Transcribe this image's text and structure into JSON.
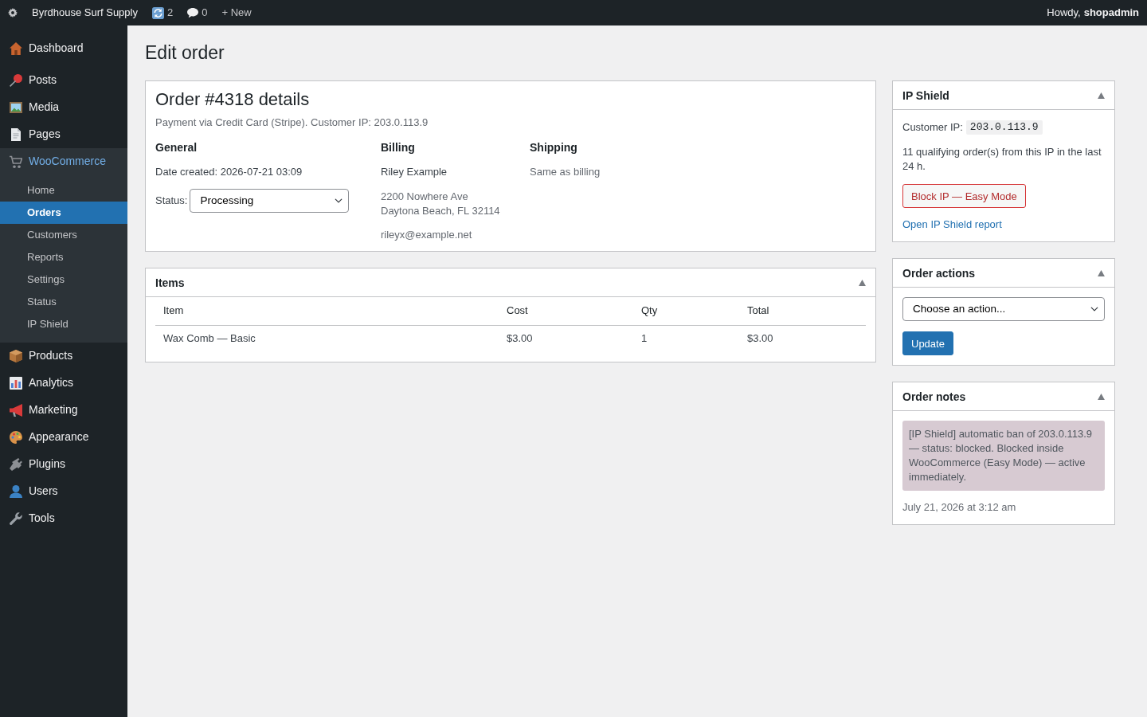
{
  "admin_bar": {
    "site_name": "Byrdhouse Surf Supply",
    "updates_count": "2",
    "comments_count": "0",
    "new_label": "+ New",
    "greeting": "Howdy, **shopadmin**"
  },
  "sidebar": {
    "items": [
      {
        "label": "Dashboard",
        "selected": false
      },
      {
        "label": "Posts",
        "selected": false
      },
      {
        "label": "Media",
        "selected": false
      },
      {
        "label": "Pages",
        "selected": false
      },
      {
        "label": "WooCommerce",
        "selected": true,
        "children": [
          {
            "label": "Home",
            "selected": false
          },
          {
            "label": "Orders",
            "selected": true
          },
          {
            "label": "Customers",
            "selected": false
          },
          {
            "label": "Reports",
            "selected": false
          },
          {
            "label": "Settings",
            "selected": false
          },
          {
            "label": "Status",
            "selected": false
          },
          {
            "label": "IP Shield",
            "selected": false
          }
        ]
      },
      {
        "label": "Products",
        "selected": false
      },
      {
        "label": "Analytics",
        "selected": false
      },
      {
        "label": "Marketing",
        "selected": false
      },
      {
        "label": "Appearance",
        "selected": false
      },
      {
        "label": "Plugins",
        "selected": false
      },
      {
        "label": "Users",
        "selected": false
      },
      {
        "label": "Tools",
        "selected": false
      }
    ]
  },
  "page_title": "Edit order",
  "order_details": {
    "title": "Order #4318 details",
    "payment_line": "Payment via Credit Card (Stripe). Customer IP: 203.0.113.9",
    "general": {
      "heading": "General",
      "date_created": "Date created: 2026-07-21 03:09",
      "status_label": "Status:",
      "status": "Processing"
    },
    "billing": {
      "heading": "Billing",
      "name": "Riley Example",
      "address_lines": [
        "2200 Nowhere Ave",
        "Daytona Beach, FL 32114"
      ],
      "email": "rileyx@example.net"
    },
    "shipping": {
      "heading": "Shipping",
      "note": "Same as billing"
    }
  },
  "items_box": {
    "title": "Items",
    "columns": [
      "Item",
      "Cost",
      "Qty",
      "Total"
    ],
    "rows": [
      [
        "Wax Comb — Basic",
        "$3.00",
        "1",
        "$3.00"
      ]
    ]
  },
  "ip_shield": {
    "title": "IP Shield",
    "customer_ip_label": "Customer IP:",
    "customer_ip": "203.0.113.9",
    "order_count_text": "11 qualifying order(s) from this IP in the last 24 h.",
    "block_button": "Block IP — Easy Mode",
    "report_link": "Open IP Shield report"
  },
  "order_actions": {
    "title": "Order actions",
    "action_select": "Choose an action...",
    "update_button": "Update"
  },
  "order_notes": {
    "title": "Order notes",
    "notes": [
      {
        "text": "[IP Shield] automatic ban of 203.0.113.9 — status: blocked. Blocked inside WooCommerce (Easy Mode) — active immediately.",
        "date": "July 21, 2026 at 3:12 am"
      }
    ]
  }
}
